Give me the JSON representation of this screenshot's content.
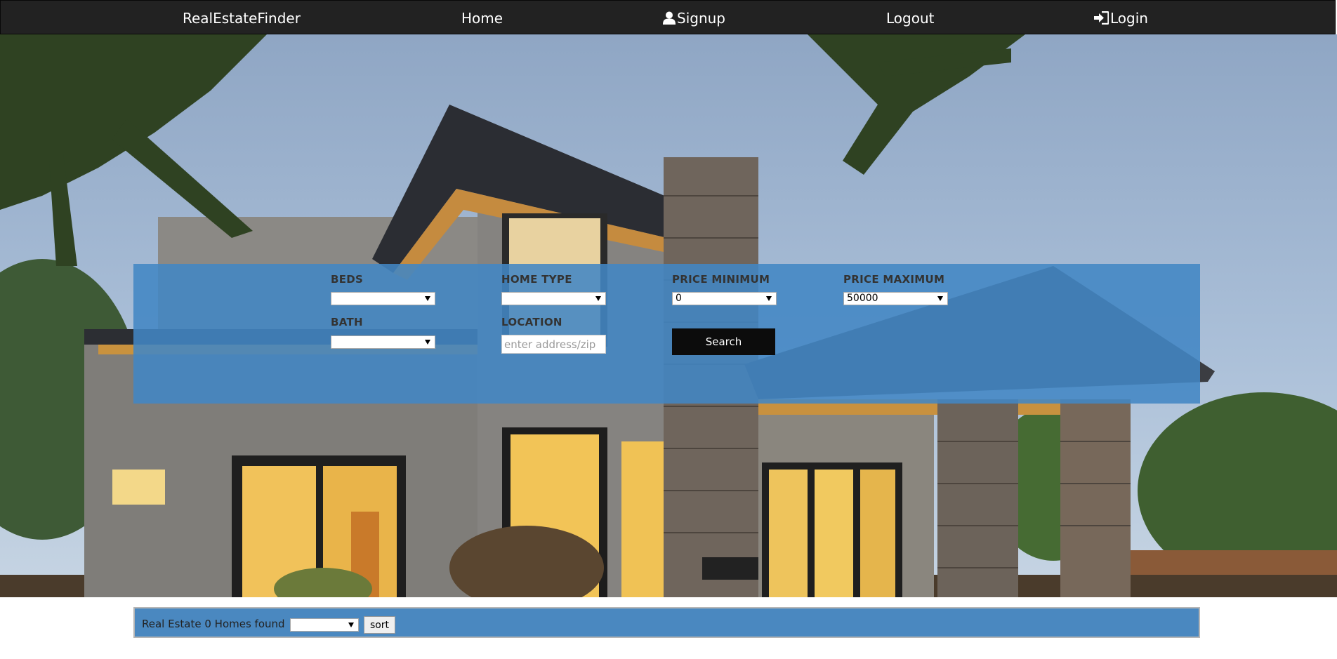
{
  "nav": {
    "brand": "RealEstateFinder",
    "home": "Home",
    "signup": "Signup",
    "logout": "Logout",
    "login": "Login"
  },
  "search": {
    "beds_label": "BEDS",
    "beds_value": "",
    "home_type_label": "HOME TYPE",
    "home_type_value": "",
    "price_min_label": "PRICE MINIMUM",
    "price_min_value": "0",
    "price_max_label": "PRICE MAXIMUM",
    "price_max_value": "50000",
    "bath_label": "BATH",
    "bath_value": "",
    "location_label": "LOCATION",
    "location_placeholder": "enter address/zip",
    "location_value": "",
    "search_button": "Search"
  },
  "results": {
    "summary": "Real Estate 0 Homes found",
    "sort_value": "",
    "sort_button": "sort"
  },
  "colors": {
    "navbar": "#222222",
    "panel": "#4286c4",
    "results_bar": "#4a88c0",
    "search_button": "#0c0c0c"
  }
}
